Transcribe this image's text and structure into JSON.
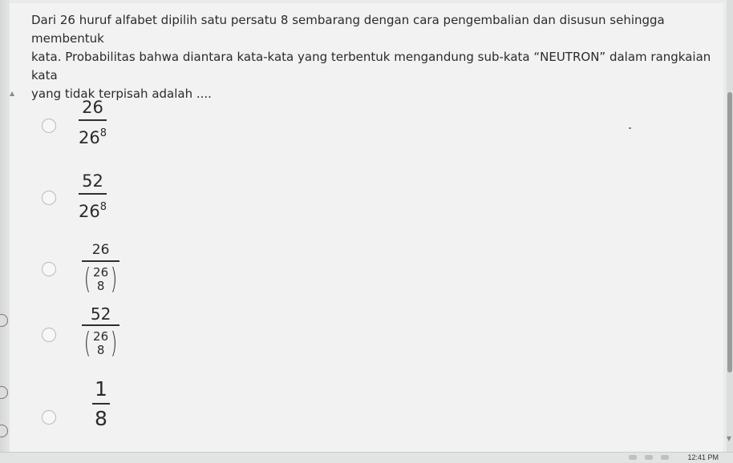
{
  "question": {
    "line1": "Dari 26 huruf alfabet dipilih satu persatu 8 sembarang dengan cara pengembalian dan disusun sehingga membentuk",
    "line2": "kata. Probabilitas bahwa diantara kata-kata yang terbentuk mengandung sub-kata “NEUTRON” dalam rangkaian kata",
    "line3": "yang tidak terpisah adalah ...."
  },
  "options": [
    {
      "numerator": "26",
      "den_base": "26",
      "den_exp": "8"
    },
    {
      "numerator": "52",
      "den_base": "26",
      "den_exp": "8"
    },
    {
      "numerator": "26",
      "binom_top": "26",
      "binom_bottom": "8"
    },
    {
      "numerator": "52",
      "binom_top": "26",
      "binom_bottom": "8"
    },
    {
      "numerator": "1",
      "denominator": "8"
    }
  ],
  "taskbar": {
    "clock": "12:41 PM"
  },
  "icons": {
    "radio": "radio-circle-icon",
    "scroll_up": "triangle-up-icon",
    "scroll_down": "triangle-down-icon"
  }
}
